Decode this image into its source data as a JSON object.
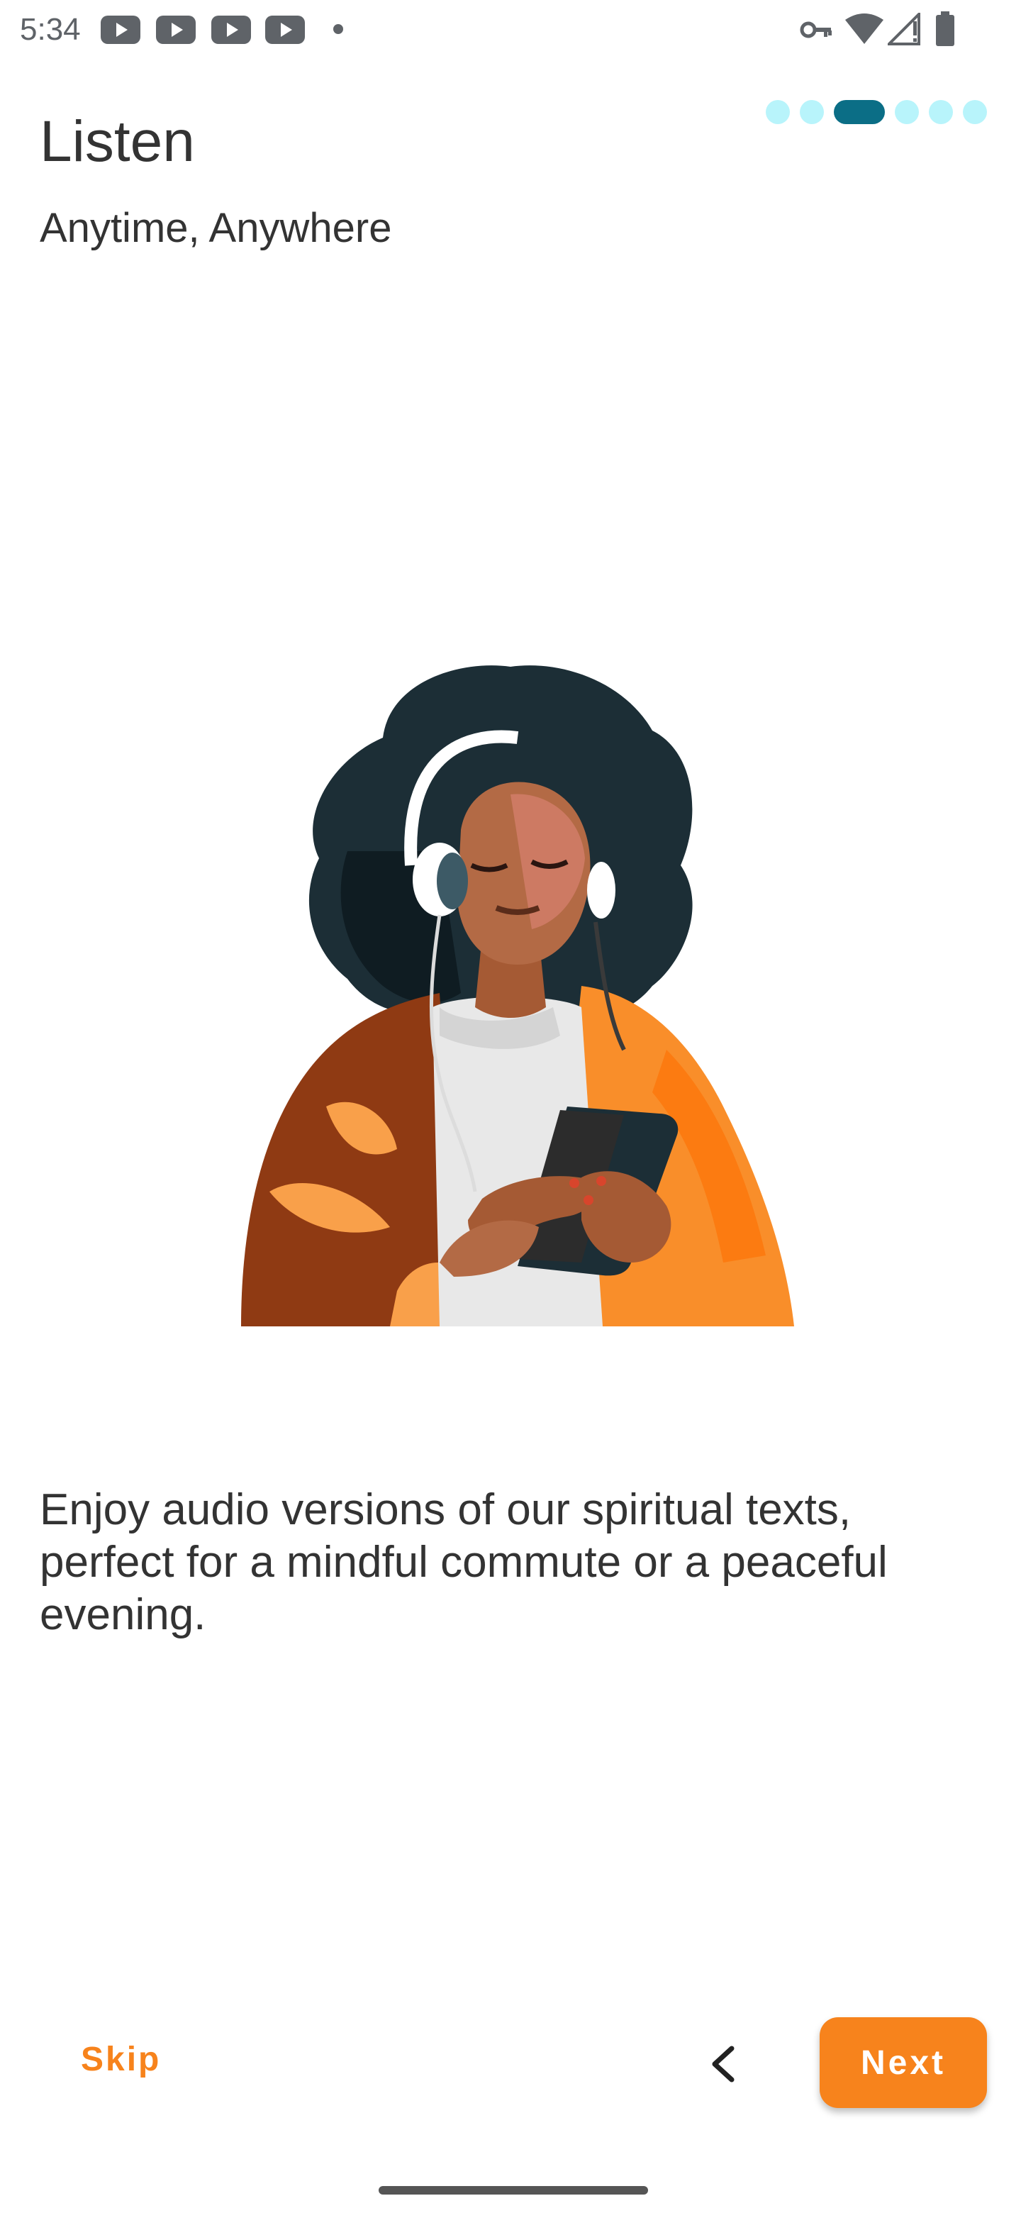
{
  "status_bar": {
    "time": "5:34",
    "notification_icons": [
      "youtube-icon",
      "youtube-icon",
      "youtube-icon",
      "youtube-icon"
    ],
    "right_icons": [
      "vpn-key-icon",
      "wifi-icon",
      "cell-signal-icon",
      "battery-icon"
    ]
  },
  "onboarding": {
    "title": "Listen",
    "subtitle": "Anytime, Anywhere",
    "description": "Enjoy audio versions of our spiritual texts, perfect for a mindful commute or a peaceful evening.",
    "illustration_icon": "woman-with-headphones-illustration",
    "page_indicator": {
      "total": 6,
      "current": 3,
      "active_color": "#0b6e86",
      "inactive_color": "#b8f4fb"
    }
  },
  "nav": {
    "skip_label": "Skip",
    "back_icon": "chevron-left-icon",
    "next_label": "Next",
    "accent_color": "#f7831c"
  }
}
